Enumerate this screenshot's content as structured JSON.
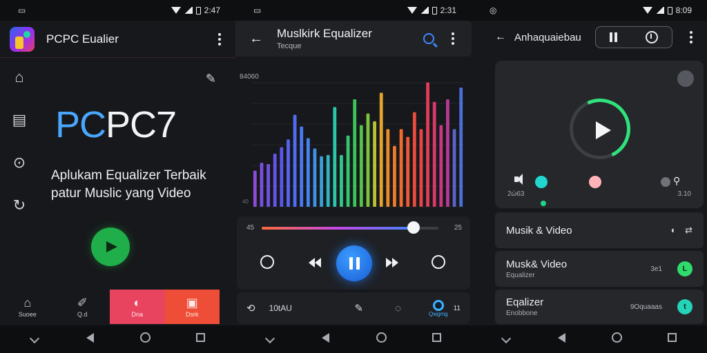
{
  "panel1": {
    "status": {
      "left": "▭",
      "time": "2:47"
    },
    "app_title": "PCPC Eualier",
    "brand_part1": "PC",
    "brand_part2": "PC7",
    "tagline": "Aplukam Equalizer Terbaik patur Muslic yang Video",
    "side_icons": [
      "home-icon",
      "file-icon",
      "search-voice-icon",
      "refresh-icon"
    ],
    "bottom_tabs": [
      {
        "label": "Suoee",
        "icon": "home-icon",
        "color": ""
      },
      {
        "label": "Q.d",
        "icon": "edit-icon",
        "color": ""
      },
      {
        "label": "Dna",
        "icon": "headphones-icon",
        "color": "#e8445f"
      },
      {
        "label": "Dsrk",
        "icon": "gallery-icon",
        "color": "#ee4e38"
      }
    ]
  },
  "panel2": {
    "status": {
      "left": "▭",
      "time": "2:31"
    },
    "title": "Muslkirk Equalizer",
    "subtitle": "Tecque",
    "chart": {
      "top_label": "84060",
      "bottom_label": "40"
    },
    "eq_bars": [
      {
        "h": 0.28,
        "c": "#8a4bd6"
      },
      {
        "h": 0.34,
        "c": "#7a4fe0"
      },
      {
        "h": 0.33,
        "c": "#6e52e6"
      },
      {
        "h": 0.41,
        "c": "#6454ea"
      },
      {
        "h": 0.46,
        "c": "#5a57ee"
      },
      {
        "h": 0.52,
        "c": "#5566f0"
      },
      {
        "h": 0.71,
        "c": "#4f6cf2"
      },
      {
        "h": 0.62,
        "c": "#4a78f1"
      },
      {
        "h": 0.53,
        "c": "#4584ef"
      },
      {
        "h": 0.45,
        "c": "#3e90e8"
      },
      {
        "h": 0.39,
        "c": "#38a0d8"
      },
      {
        "h": 0.4,
        "c": "#2fb5c0"
      },
      {
        "h": 0.77,
        "c": "#2ac8a8"
      },
      {
        "h": 0.4,
        "c": "#2ec98a"
      },
      {
        "h": 0.55,
        "c": "#34c56d"
      },
      {
        "h": 0.83,
        "c": "#3cc35a"
      },
      {
        "h": 0.63,
        "c": "#52c548"
      },
      {
        "h": 0.72,
        "c": "#7bc43d"
      },
      {
        "h": 0.66,
        "c": "#b9c235"
      },
      {
        "h": 0.88,
        "c": "#e2a42c"
      },
      {
        "h": 0.6,
        "c": "#ea8a2a"
      },
      {
        "h": 0.47,
        "c": "#ee7a2c"
      },
      {
        "h": 0.6,
        "c": "#ef6b30"
      },
      {
        "h": 0.54,
        "c": "#ee5a36"
      },
      {
        "h": 0.73,
        "c": "#ea4c3e"
      },
      {
        "h": 0.6,
        "c": "#e64449"
      },
      {
        "h": 0.96,
        "c": "#e03d58"
      },
      {
        "h": 0.81,
        "c": "#d6396a"
      },
      {
        "h": 0.63,
        "c": "#c9377e"
      },
      {
        "h": 0.83,
        "c": "#b43a94"
      },
      {
        "h": 0.6,
        "c": "#5a64c8"
      },
      {
        "h": 0.92,
        "c": "#4a70d8"
      }
    ],
    "time_start": "45",
    "time_end": "25",
    "progress": 0.86,
    "tool_label": "10tAU",
    "tool_active_label": "Qwgmg",
    "tool_count": "11"
  },
  "panel3": {
    "status": {
      "left": "◎",
      "time": "8:09"
    },
    "title": "Anhaquaiebau",
    "time_start": "2ώ63",
    "time_end": "3.10",
    "player_progress": 0.33,
    "list": [
      {
        "title": "Musik & Video",
        "sub": "",
        "meta": "",
        "badge": "",
        "badge_color": ""
      },
      {
        "title": "Musk& Video",
        "sub": "Equalizer",
        "meta": "3e1",
        "badge": "L",
        "badge_color": "#2fdc6b"
      },
      {
        "title": "Eqalizer",
        "sub": "Enobbone",
        "meta": "9Oquaaas",
        "badge": "t",
        "badge_color": "#24d3b8"
      }
    ]
  }
}
